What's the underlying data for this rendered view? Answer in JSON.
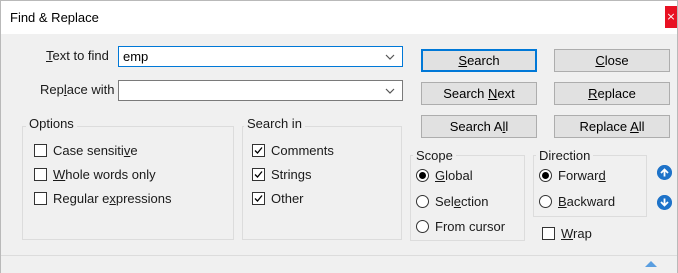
{
  "window": {
    "title": "Find & Replace",
    "close_glyph": "×"
  },
  "find": {
    "label_prefix": "",
    "label_u": "T",
    "label_rest": "ext to find",
    "value": "emp"
  },
  "replace": {
    "label_prefix": "Rep",
    "label_u": "l",
    "label_rest": "ace with",
    "value": ""
  },
  "buttons": {
    "search": {
      "pre": "",
      "u": "S",
      "post": "earch"
    },
    "close": {
      "pre": "",
      "u": "C",
      "post": "lose"
    },
    "search_next": {
      "pre": "Search ",
      "u": "N",
      "post": "ext"
    },
    "replace": {
      "pre": "",
      "u": "R",
      "post": "eplace"
    },
    "search_all": {
      "pre": "Search A",
      "u": "l",
      "post": "l"
    },
    "replace_all": {
      "pre": "Replace ",
      "u": "A",
      "post": "ll"
    }
  },
  "options": {
    "title": "Options",
    "items": [
      {
        "pre": "Case sensiti",
        "u": "v",
        "post": "e",
        "checked": false
      },
      {
        "pre": "",
        "u": "W",
        "post": "hole words only",
        "checked": false
      },
      {
        "pre": "Regular e",
        "u": "x",
        "post": "pressions",
        "checked": false
      }
    ]
  },
  "search_in": {
    "title": "Search in",
    "items": [
      {
        "label": "Comments",
        "checked": true
      },
      {
        "label": "Strings",
        "checked": true
      },
      {
        "label": "Other",
        "checked": true
      }
    ]
  },
  "scope": {
    "title": "Scope",
    "items": [
      {
        "pre": "",
        "u": "G",
        "post": "lobal",
        "selected": true
      },
      {
        "pre": "Sel",
        "u": "e",
        "post": "ction",
        "selected": false
      },
      {
        "pre": "From cursor",
        "u": "",
        "post": "",
        "selected": false
      }
    ]
  },
  "direction": {
    "title": "Direction",
    "items": [
      {
        "pre": "Forwar",
        "u": "d",
        "post": "",
        "selected": true
      },
      {
        "pre": "",
        "u": "B",
        "post": "ackward",
        "selected": false
      }
    ]
  },
  "wrap": {
    "pre": "",
    "u": "W",
    "post": "rap",
    "checked": false
  },
  "icons": {
    "up": "arrow-up-circle-icon",
    "down": "arrow-down-circle-icon",
    "collapse": "triangle-up-icon"
  },
  "colors": {
    "accent": "#0078d7",
    "close_red": "#e81123",
    "round_btn": "#1e73c9"
  }
}
